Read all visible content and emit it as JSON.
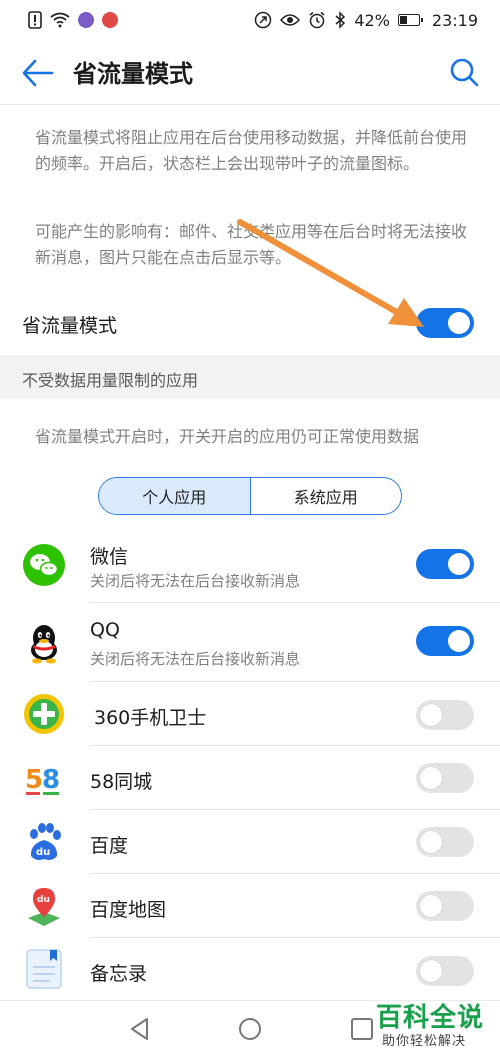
{
  "status_bar": {
    "battery": "42%",
    "time": "23:19",
    "battery_level": 0.42
  },
  "header": {
    "title": "省流量模式"
  },
  "description": {
    "paragraph1": "省流量模式将阻止应用在后台使用移动数据，并降低前台使用的频率。开启后，状态栏上会出现带叶子的流量图标。",
    "paragraph2": "可能产生的影响有：邮件、社交类应用等在后台时将无法接收新消息，图片只能在点击后显示等。"
  },
  "main_toggle": {
    "label": "省流量模式",
    "state": "on"
  },
  "section": {
    "header": "不受数据用量限制的应用",
    "note": "省流量模式开启时，开关开启的应用仍可正常使用数据"
  },
  "tabs": [
    {
      "label": "个人应用",
      "active": true
    },
    {
      "label": "系统应用",
      "active": false
    }
  ],
  "apps": [
    {
      "name": "微信",
      "subtitle": "关闭后将无法在后台接收新消息",
      "icon": "wechat-icon",
      "enabled": true
    },
    {
      "name": "QQ",
      "subtitle": "关闭后将无法在后台接收新消息",
      "icon": "qq-icon",
      "enabled": true
    },
    {
      "name": "360手机卫士",
      "icon": "360-security-icon",
      "enabled": false
    },
    {
      "name": "58同城",
      "icon": "58-tongcheng-icon",
      "enabled": false
    },
    {
      "name": "百度",
      "icon": "baidu-icon",
      "enabled": false
    },
    {
      "name": "百度地图",
      "icon": "baidu-map-icon",
      "enabled": false
    },
    {
      "name": "备忘录",
      "icon": "notes-icon",
      "enabled": false
    }
  ],
  "watermark": {
    "main": "百科全说",
    "sub": "助你轻松解决"
  },
  "colors": {
    "accent": "#1473e6",
    "toggle_off": "#e3e3e3",
    "arrow": "#f0903a",
    "watermark": "#19a04a"
  }
}
